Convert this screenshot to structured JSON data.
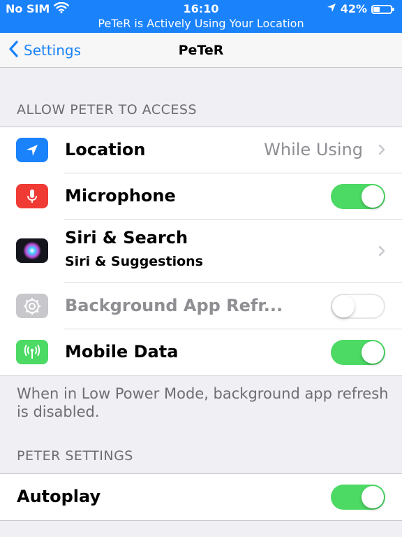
{
  "status_bar": {
    "carrier": "No SIM",
    "time": "16:10",
    "battery_percent": "42%",
    "battery_level": 0.42,
    "banner": "PeTeR is Actively Using Your Location",
    "color": "#1a82fb"
  },
  "nav": {
    "back_label": "Settings",
    "title": "PeTeR"
  },
  "section_access": {
    "header": "ALLOW PETER TO ACCESS",
    "items": [
      {
        "label": "Location",
        "value": "While Using",
        "icon": "location-arrow-icon",
        "icon_color": "#1a82fb",
        "control": "chevron"
      },
      {
        "label": "Microphone",
        "icon": "microphone-icon",
        "icon_color": "#f03b35",
        "control": "toggle",
        "on": true
      },
      {
        "label": "Siri & Search",
        "sublabel": "Siri & Suggestions",
        "icon": "siri-icon",
        "control": "chevron"
      },
      {
        "label": "Background App Refr...",
        "icon": "gear-icon",
        "icon_color": "#c7c7cc",
        "control": "toggle",
        "on": false,
        "disabled": true
      },
      {
        "label": "Mobile Data",
        "icon": "antenna-icon",
        "icon_color": "#4cd964",
        "control": "toggle",
        "on": true
      }
    ],
    "footer": "When in Low Power Mode, background app refresh is disabled."
  },
  "section_peter": {
    "header": "PETER SETTINGS",
    "items": [
      {
        "label": "Autoplay",
        "control": "toggle",
        "on": true
      }
    ]
  }
}
